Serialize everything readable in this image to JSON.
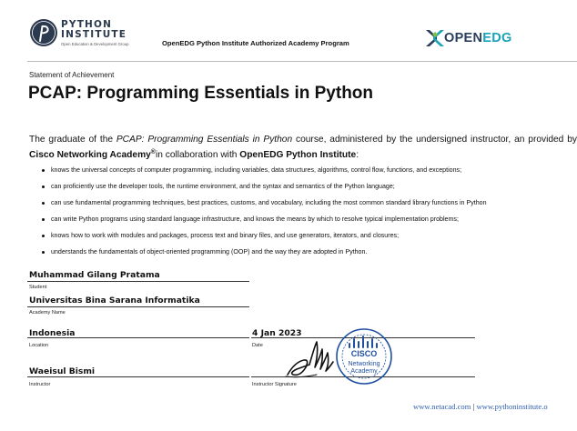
{
  "header": {
    "institute_name_line1": "PYTHON",
    "institute_name_line2": "INSTITUTE",
    "institute_tagline": "Open Education & Development Group",
    "program_title": "OpenEDG Python Institute Authorized Academy Program",
    "partner_logo_part1": "OPEN",
    "partner_logo_part2": "EDG"
  },
  "certificate": {
    "statement_label": "Statement of Achievement",
    "course_title": "PCAP: Programming Essentials in Python",
    "intro": {
      "p1": "The graduate of the ",
      "course_italic": "PCAP: Programming Essentials in Python",
      "p2": " course, administered by the undersigned instructor, an provided by ",
      "org1": "Cisco Networking Academy",
      "registered_mark": "®",
      "p3": "in collaboration with ",
      "org2": "OpenEDG Python Institute",
      "p4": ":"
    },
    "outcomes": [
      "knows the universal concepts of computer programming, including variables, data structures, algorithms, control flow, functions, and exceptions;",
      "can proficiently use the developer tools, the runtime environment, and the syntax and semantics of the Python language;",
      "can use fundamental programming techniques, best practices, customs, and vocabulary, including the most common standard library functions in Python",
      "can write Python programs using standard language infrastructure, and knows the means by which to resolve typical implementation problems;",
      "knows how to work with modules and packages, process text and binary files, and use generators, iterators, and closures;",
      "understands the fundamentals of object-oriented programming (OOP) and the way they are adopted in Python."
    ]
  },
  "fields": {
    "student": {
      "value": "Muhammad Gilang Pratama",
      "label": "Student"
    },
    "academy": {
      "value": "Universitas Bina Sarana Informatika",
      "label": "Academy Name"
    },
    "location": {
      "value": "Indonesia",
      "label": "Location"
    },
    "date": {
      "value": "4 Jan 2023",
      "label": "Date"
    },
    "instructor": {
      "value": "Waeisul Bismi",
      "label": "Instructor"
    },
    "instructor_signature": {
      "label": "Instructor Signature"
    }
  },
  "seal": {
    "brand": "CISCO",
    "line1": "Networking",
    "line2": "Academy"
  },
  "footer": {
    "link1": "www.netacad.com",
    "separator": "|",
    "link2": "www.pythoninstitute.o"
  },
  "colors": {
    "python_navy": "#2b3a4e",
    "openedg_navy": "#2a3d5c",
    "openedg_teal": "#1aa3b8",
    "seal_blue": "#1f4fa0",
    "link_blue": "#2f5fb0"
  }
}
